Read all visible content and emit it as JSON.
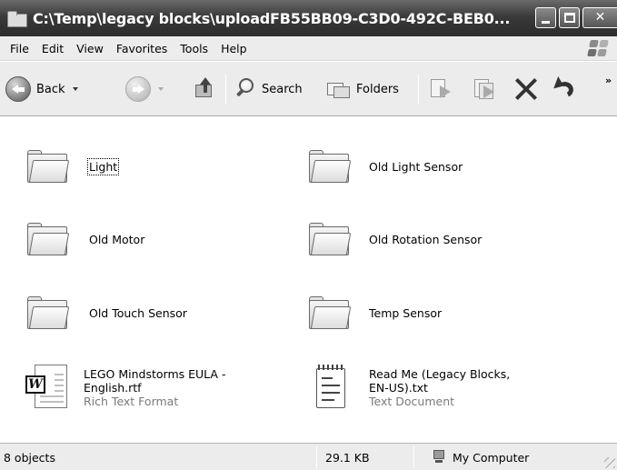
{
  "window": {
    "title": "C:\\Temp\\legacy blocks\\uploadFB55BB09-C3D0-492C-BEB0..."
  },
  "menu": [
    "File",
    "Edit",
    "View",
    "Favorites",
    "Tools",
    "Help"
  ],
  "toolbar": {
    "back_label": "Back",
    "search_label": "Search",
    "folders_label": "Folders",
    "more_glyph": "»"
  },
  "folders": [
    {
      "name": "Light"
    },
    {
      "name": "Old Light Sensor"
    },
    {
      "name": "Old Motor"
    },
    {
      "name": "Old Rotation Sensor"
    },
    {
      "name": "Old Touch Sensor"
    },
    {
      "name": "Temp Sensor"
    }
  ],
  "files": [
    {
      "name_line1": "LEGO Mindstorms EULA -",
      "name_line2": "English.rtf",
      "type": "Rich Text Format",
      "icon": "word-document-icon"
    },
    {
      "name_line1": "Read Me (Legacy Blocks,",
      "name_line2": "EN-US).txt",
      "type": "Text Document",
      "icon": "notepad-document-icon"
    }
  ],
  "status": {
    "objects": "8 objects",
    "size": "29.1 KB",
    "location": "My Computer"
  }
}
